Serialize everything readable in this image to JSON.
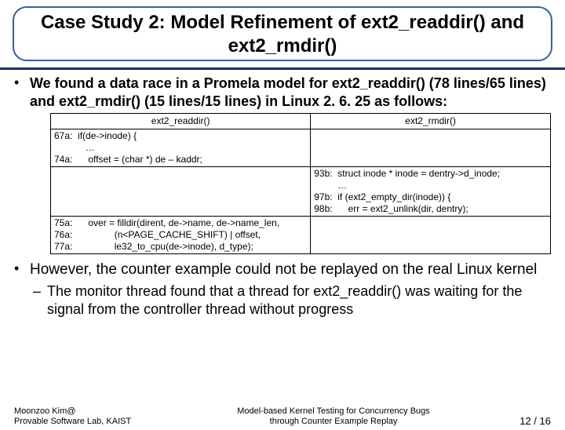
{
  "title": "Case Study 2: Model Refinement of ext2_readdir() and ext2_rmdir()",
  "bullet1": "We found a data race in a Promela model for ext2_readdir() (78 lines/65 lines)  and ext2_rmdir() (15 lines/15 lines) in Linux 2. 6. 25 as follows:",
  "table": {
    "head_left": "ext2_readdir()",
    "head_right": "ext2_rmdir()",
    "r1_left": "67a:  if(de->inode) {\n            …\n74a:      offset = (char *) de – kaddr;",
    "r1_right": "",
    "r2_left": "",
    "r2_right": "93b:  struct inode * inode = dentry->d_inode;\n         …\n97b:  if (ext2_empty_dir(inode)) {\n98b:      err = ext2_unlink(dir, dentry);",
    "r3_left": "75a:      over = filldir(dirent, de->name, de->name_len,\n76a:                (n<PAGE_CACHE_SHIFT) | offset,\n77a:                le32_to_cpu(de->inode), d_type);",
    "r3_right": ""
  },
  "bullet2": "However, the counter example could not be replayed on the real Linux kernel",
  "sub1": "The monitor thread found that a thread for ext2_readdir() was waiting for the signal from the controller thread without progress",
  "footer": {
    "left1": "Moonzoo Kim@",
    "left2": "Provable Software Lab, KAIST",
    "center1": "Model-based Kernel Testing for Concurrency Bugs",
    "center2": "through Counter Example Replay",
    "right": "12 / 16"
  }
}
